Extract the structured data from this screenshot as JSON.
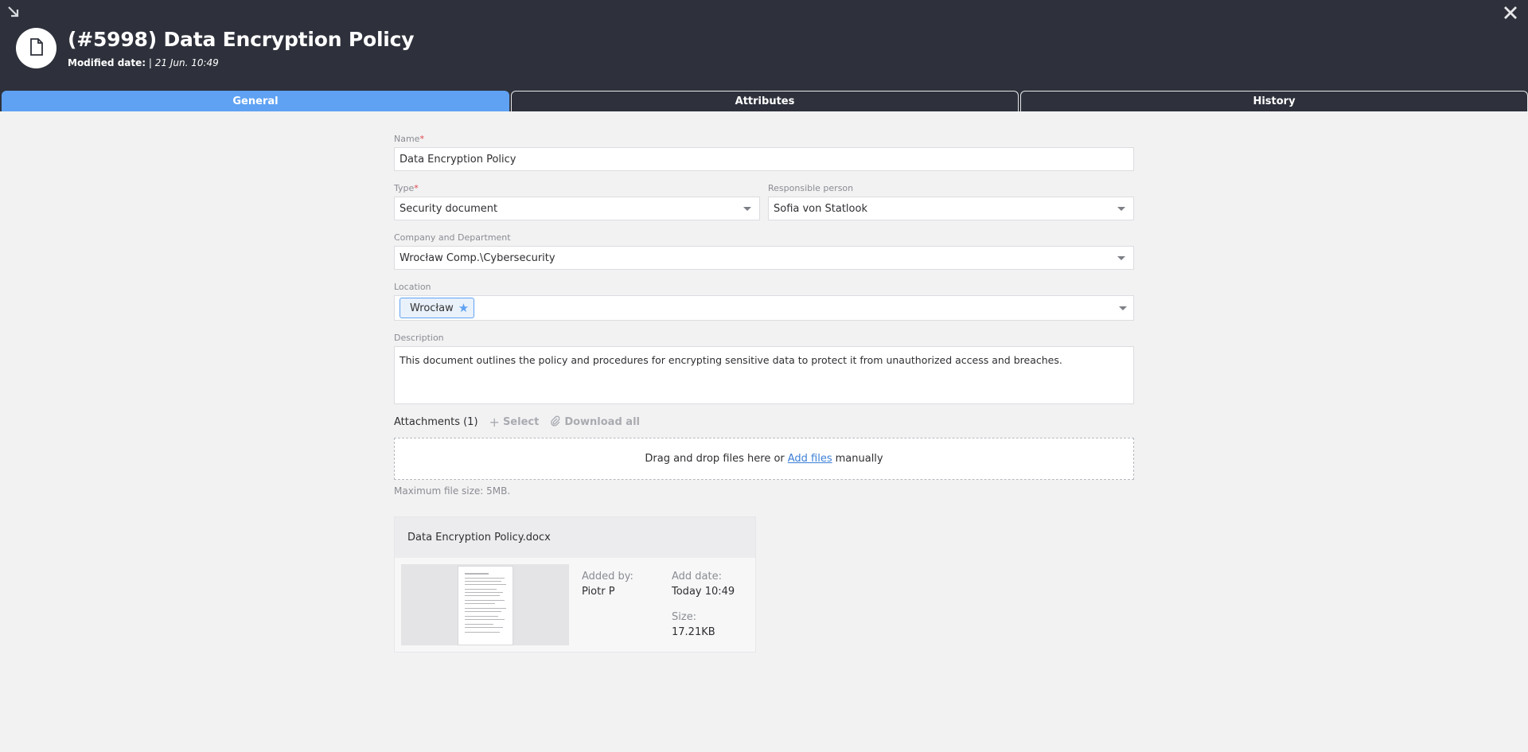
{
  "header": {
    "title": "(#5998) Data Encryption Policy",
    "modified_label": "Modified date:",
    "modified_value": "| 21 Jun. 10:49"
  },
  "tabs": [
    {
      "label": "General",
      "active": true
    },
    {
      "label": "Attributes",
      "active": false
    },
    {
      "label": "History",
      "active": false
    }
  ],
  "form": {
    "name": {
      "label": "Name",
      "required_mark": "*",
      "value": "Data Encryption Policy"
    },
    "type": {
      "label": "Type",
      "required_mark": "*",
      "value": "Security document"
    },
    "responsible": {
      "label": "Responsible person",
      "value": "Sofia von Statlook"
    },
    "company": {
      "label": "Company and Department",
      "value": "Wrocław Comp.\\Cybersecurity"
    },
    "location": {
      "label": "Location",
      "chip": "Wrocław"
    },
    "description": {
      "label": "Description",
      "value": "This document outlines the policy and procedures for encrypting sensitive data to protect it from unauthorized access and breaches."
    }
  },
  "attachments": {
    "title": "Attachments (1)",
    "select_label": "Select",
    "download_label": "Download all",
    "drop_prefix": "Drag and drop files here or",
    "drop_link": "Add files",
    "drop_suffix": "manually",
    "max_size": "Maximum file size: 5MB.",
    "file": {
      "name": "Data Encryption Policy.docx",
      "added_by_label": "Added by:",
      "added_by": "Piotr P",
      "add_date_label": "Add date:",
      "add_date": "Today 10:49",
      "size_label": "Size:",
      "size": "17.21KB"
    }
  },
  "colors": {
    "header_bg": "#2e313b",
    "tab_active": "#5fa2f3",
    "page_bg": "#f2f2f3",
    "link": "#3c7fd6",
    "required": "#e0434a"
  }
}
